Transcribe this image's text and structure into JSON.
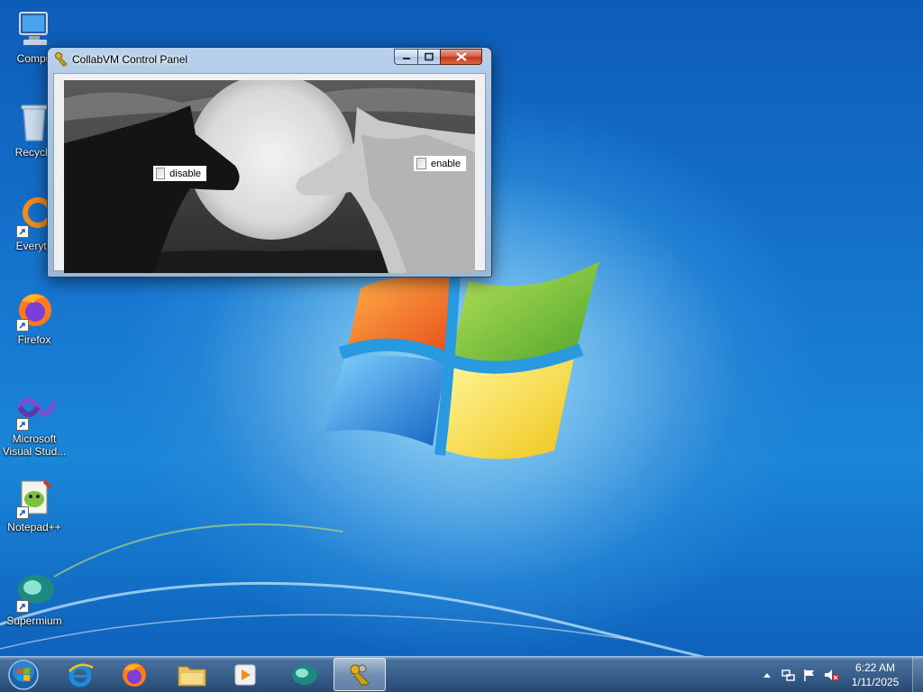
{
  "desktop_icons": [
    {
      "name": "computer",
      "label": "Computer",
      "label_visible": "Compu"
    },
    {
      "name": "recycle-bin",
      "label": "Recycle",
      "label_visible": "Recycle"
    },
    {
      "name": "everything",
      "label": "Everyth",
      "label_visible": "Everyth"
    },
    {
      "name": "firefox",
      "label": "Firefox",
      "label_visible": "Firefox"
    },
    {
      "name": "visual-studio",
      "label": "Microsoft\nVisual Stud...",
      "label_visible": "Microsoft\nVisual Stud..."
    },
    {
      "name": "notepad-plus-plus",
      "label": "Notepad++",
      "label_visible": "Notepad++"
    },
    {
      "name": "supermium",
      "label": "Supermium",
      "label_visible": "Supermium"
    }
  ],
  "window": {
    "title": "CollabVM Control Panel",
    "disable_label": "disable",
    "enable_label": "enable"
  },
  "taskbar": {
    "buttons": [
      {
        "name": "internet-explorer",
        "active": false
      },
      {
        "name": "firefox",
        "active": false
      },
      {
        "name": "file-explorer",
        "active": false
      },
      {
        "name": "media-player",
        "active": false
      },
      {
        "name": "supermium",
        "active": false
      },
      {
        "name": "collabvm-control-panel",
        "active": true
      }
    ]
  },
  "tray": {
    "time": "6:22 AM",
    "date": "1/11/2025"
  },
  "colors": {
    "desktop_bg": "#1a6fc4",
    "close_red": "#c1381b"
  }
}
